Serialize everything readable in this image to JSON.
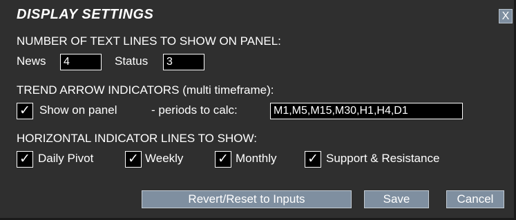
{
  "dialog": {
    "title": "DISPLAY SETTINGS",
    "close_label": "X"
  },
  "text_lines": {
    "heading": "NUMBER OF TEXT LINES TO SHOW ON PANEL:",
    "news_label": "News",
    "news_value": "4",
    "status_label": "Status",
    "status_value": "3"
  },
  "trend": {
    "heading": "TREND ARROW INDICATORS (multi timeframe):",
    "show_checked": "✓",
    "show_label": "Show on panel",
    "periods_label": "- periods to calc:",
    "periods_value": "M1,M5,M15,M30,H1,H4,D1"
  },
  "horizontal": {
    "heading": "HORIZONTAL INDICATOR LINES TO SHOW:",
    "items": [
      {
        "label": "Daily Pivot",
        "check": "✓"
      },
      {
        "label": "Weekly",
        "check": "✓"
      },
      {
        "label": "Monthly",
        "check": "✓"
      },
      {
        "label": "Support & Resistance",
        "check": "✓"
      }
    ]
  },
  "buttons": {
    "revert_label": "Revert/Reset to Inputs",
    "save_label": "Save",
    "cancel_label": "Cancel"
  },
  "colors": {
    "background": "#2f2f2f",
    "button": "#7f8fa0",
    "field_bg": "#000000",
    "text": "#ffffff"
  }
}
